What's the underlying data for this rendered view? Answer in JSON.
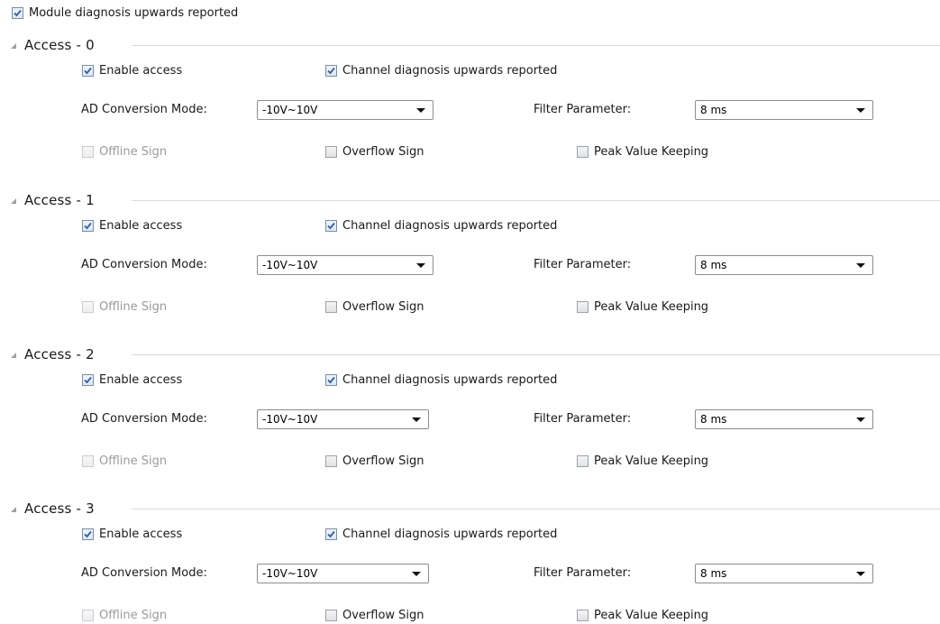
{
  "module": {
    "diag_label": "Module diagnosis upwards reported",
    "diag_checked": true
  },
  "accesses": [
    {
      "title": "Access - 0",
      "enable_label": "Enable access",
      "channel_label": "Channel diagnosis upwards reported",
      "mode_label": "AD Conversion Mode:",
      "mode_value": "-10V~10V",
      "filter_label": "Filter Parameter:",
      "filter_value": "8 ms",
      "offline_label": "Offline Sign",
      "overflow_label": "Overflow Sign",
      "peak_label": "Peak Value Keeping"
    },
    {
      "title": "Access - 1",
      "enable_label": "Enable access",
      "channel_label": "Channel diagnosis upwards reported",
      "mode_label": "AD Conversion Mode:",
      "mode_value": "-10V~10V",
      "filter_label": "Filter Parameter:",
      "filter_value": "8 ms",
      "offline_label": "Offline Sign",
      "overflow_label": "Overflow Sign",
      "peak_label": "Peak Value Keeping"
    },
    {
      "title": "Access - 2",
      "enable_label": "Enable access",
      "channel_label": "Channel diagnosis upwards reported",
      "mode_label": "AD Conversion Mode:",
      "mode_value": "-10V~10V",
      "filter_label": "Filter Parameter:",
      "filter_value": "8 ms",
      "offline_label": "Offline Sign",
      "overflow_label": "Overflow Sign",
      "peak_label": "Peak Value Keeping"
    },
    {
      "title": "Access - 3",
      "enable_label": "Enable access",
      "channel_label": "Channel diagnosis upwards reported",
      "mode_label": "AD Conversion Mode:",
      "mode_value": "-10V~10V",
      "filter_label": "Filter Parameter:",
      "filter_value": "8 ms",
      "offline_label": "Offline Sign",
      "overflow_label": "Overflow Sign",
      "peak_label": "Peak Value Keeping"
    }
  ],
  "colors": {
    "checkmark": "#2f5fa8",
    "separator": "#d9d9d9",
    "disabled_text": "#9a9a9a"
  }
}
